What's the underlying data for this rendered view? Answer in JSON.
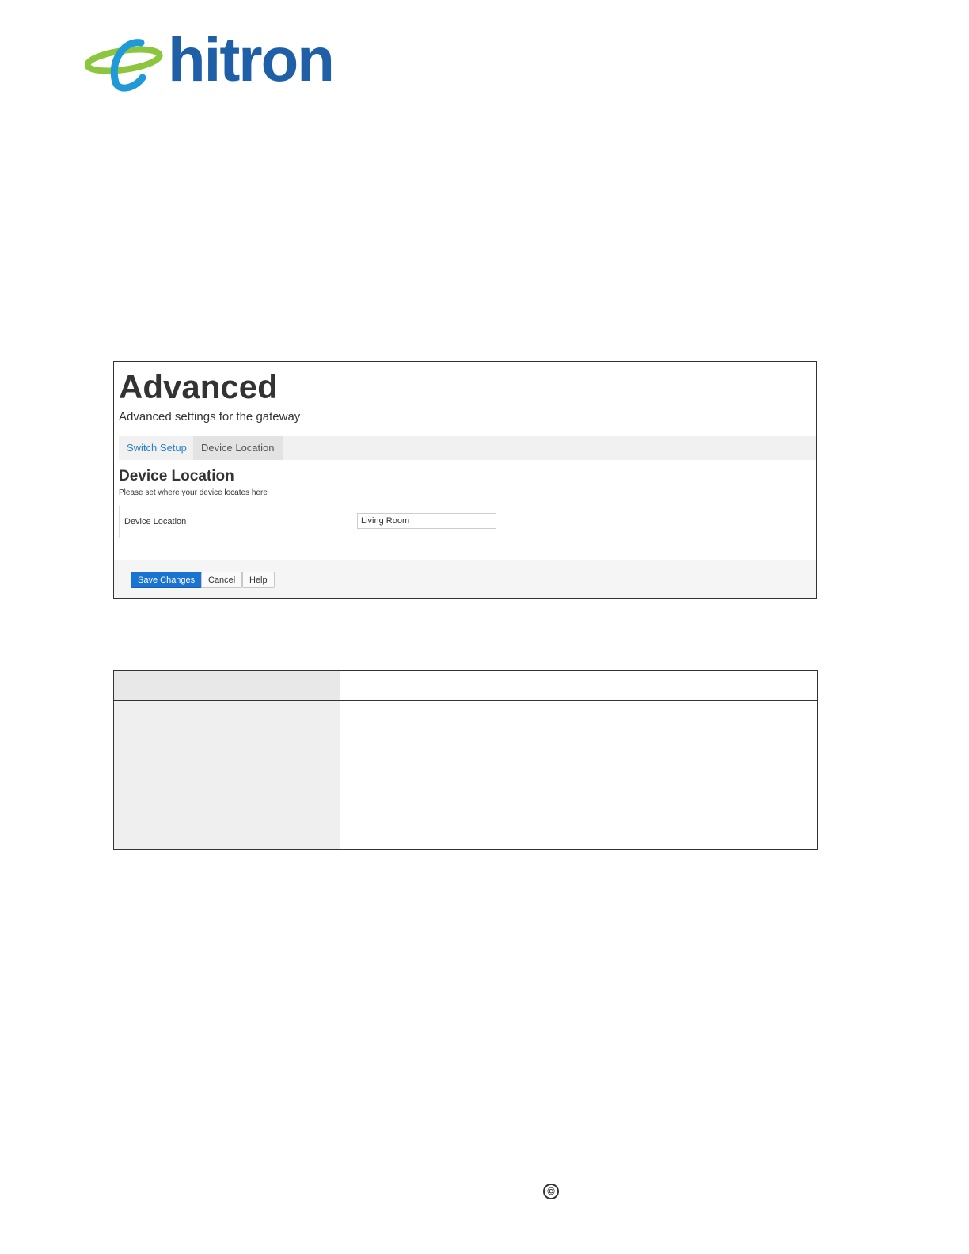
{
  "logo": {
    "text": "hitron",
    "primary_color": "#1f5fa8",
    "accent_color": "#8cc63f"
  },
  "screenshot": {
    "title": "Advanced",
    "subtitle": "Advanced settings for the gateway",
    "tabs": [
      {
        "label": "Switch Setup"
      },
      {
        "label": "Device Location"
      }
    ],
    "active_tab": "Device Location",
    "section_title": "Device Location",
    "section_desc": "Please set where your device locates here",
    "field": {
      "label": "Device Location",
      "value": "Living Room"
    },
    "buttons": {
      "save": "Save Changes",
      "cancel": "Cancel",
      "help": "Help"
    }
  },
  "footer": {
    "copyright_symbol": "©"
  }
}
